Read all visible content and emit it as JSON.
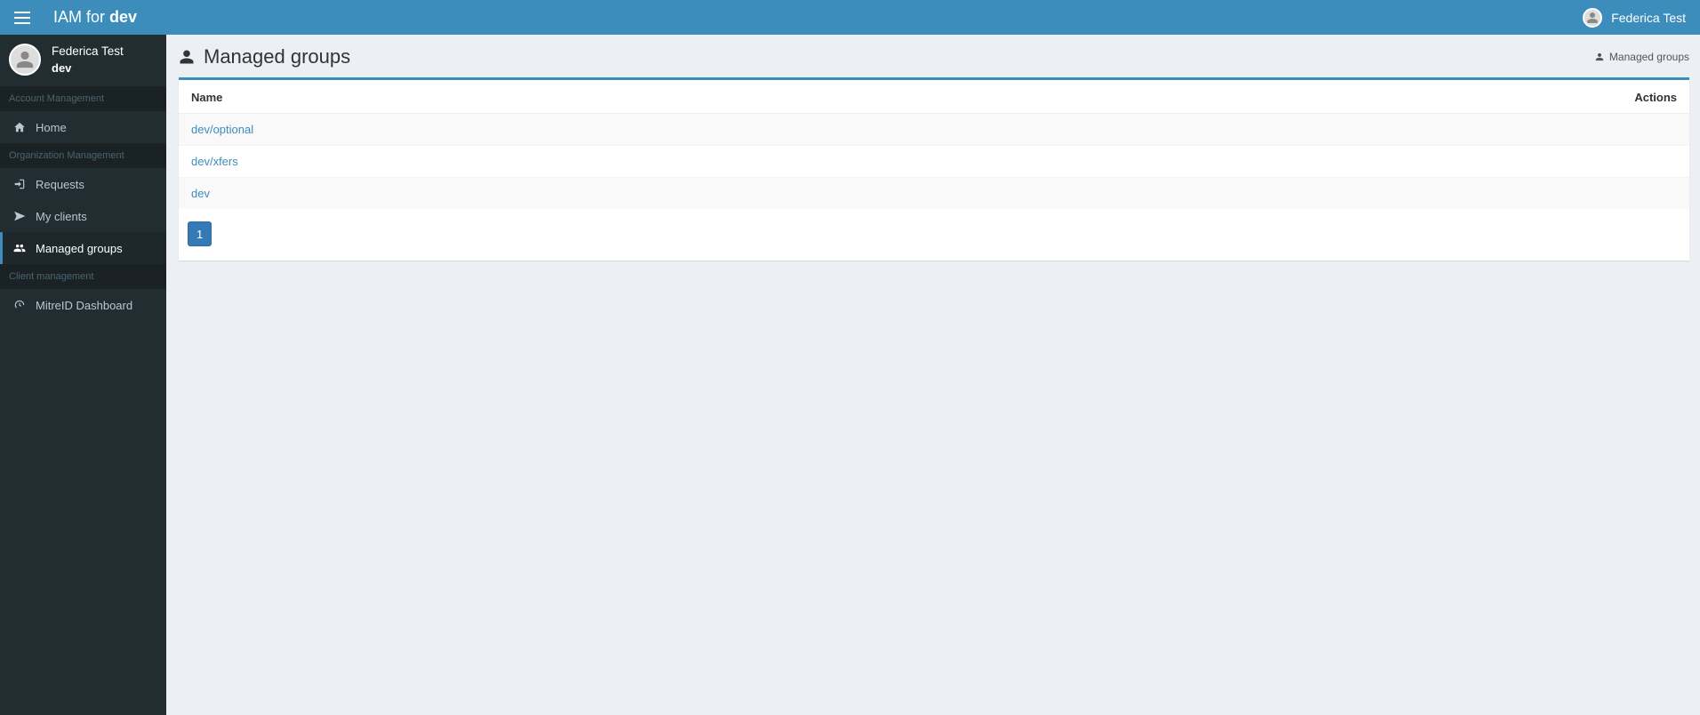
{
  "header": {
    "brand_prefix": "IAM for ",
    "brand_strong": "dev",
    "user_name": "Federica Test"
  },
  "sidebar": {
    "user_name": "Federica Test",
    "user_org": "dev",
    "sections": {
      "account": "Account Management",
      "org": "Organization Management",
      "client": "Client management"
    },
    "items": {
      "home": "Home",
      "requests": "Requests",
      "my_clients": "My clients",
      "managed_groups": "Managed groups",
      "mitre": "MitreID Dashboard"
    }
  },
  "page": {
    "title": "Managed groups",
    "breadcrumb": "Managed groups",
    "columns": {
      "name": "Name",
      "actions": "Actions"
    },
    "rows": [
      {
        "name": "dev/optional"
      },
      {
        "name": "dev/xfers"
      },
      {
        "name": "dev"
      }
    ],
    "pagination": {
      "current": "1"
    }
  }
}
